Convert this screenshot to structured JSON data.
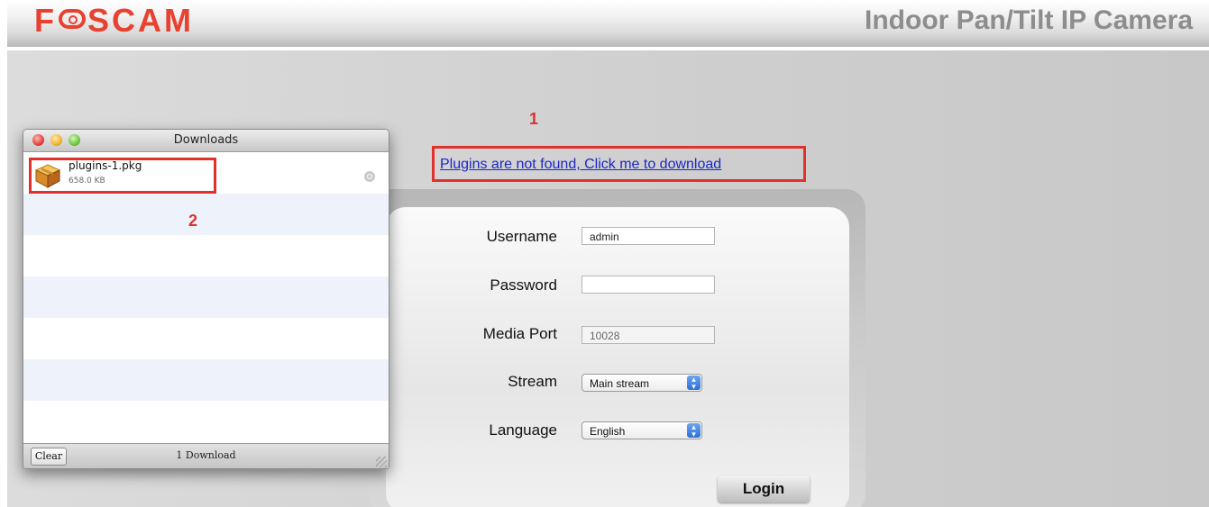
{
  "header": {
    "logo_text": "FOSCAM",
    "product_title": "Indoor Pan/Tilt IP Camera"
  },
  "annotations": {
    "marker_1": "1",
    "marker_2": "2"
  },
  "plugin_link": "Plugins are not found, Click me to download",
  "login": {
    "username_label": "Username",
    "username_value": "admin",
    "password_label": "Password",
    "password_value": "",
    "media_port_label": "Media Port",
    "media_port_value": "10028",
    "stream_label": "Stream",
    "stream_value": "Main stream",
    "language_label": "Language",
    "language_value": "English",
    "login_button": "Login"
  },
  "downloads": {
    "window_title": "Downloads",
    "item_name": "plugins-1.pkg",
    "item_size": "658.0 KB",
    "clear_button": "Clear",
    "count_text": "1 Download"
  },
  "colors": {
    "accent_red": "#e0312c",
    "logo_red": "#e8412f",
    "link_blue": "#1a28c8"
  },
  "icons": [
    "package-icon",
    "magnifier-icon",
    "select-arrows-icon",
    "resize-grip-icon"
  ]
}
